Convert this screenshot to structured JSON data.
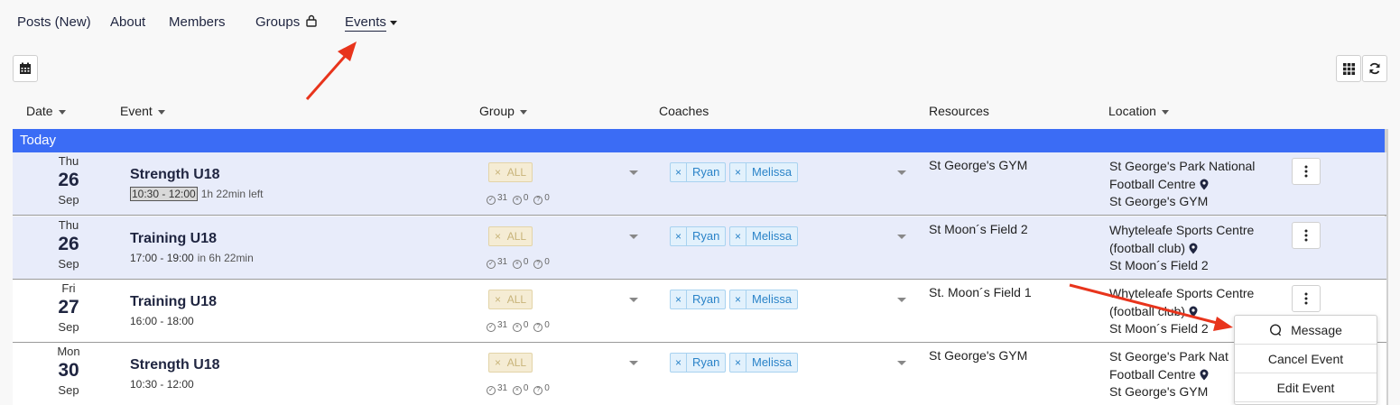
{
  "nav": {
    "items": [
      {
        "label": "Posts (New)"
      },
      {
        "label": "About"
      },
      {
        "label": "Members"
      },
      {
        "label": "Groups"
      },
      {
        "label": "Events"
      }
    ]
  },
  "table": {
    "columns": {
      "date": "Date",
      "event": "Event",
      "group": "Group",
      "coaches": "Coaches",
      "resources": "Resources",
      "location": "Location"
    },
    "section_label": "Today",
    "rows": [
      {
        "dow": "Thu",
        "day": "26",
        "month": "Sep",
        "title": "Strength U18",
        "time": "10:30 - 12:00",
        "remaining": "1h 22min left",
        "group_tag": "ALL",
        "group_remove": "×",
        "stats": {
          "yes": "31",
          "no": "0",
          "maybe": "0"
        },
        "coaches": [
          {
            "remove": "×",
            "name": "Ryan"
          },
          {
            "remove": "×",
            "name": "Melissa"
          }
        ],
        "resource": "St George's GYM",
        "location": [
          "St George's Park National",
          "Football Centre",
          "St George's GYM"
        ]
      },
      {
        "dow": "Thu",
        "day": "26",
        "month": "Sep",
        "title": "Training U18",
        "time": "17:00 - 19:00",
        "remaining": "in 6h 22min",
        "group_tag": "ALL",
        "group_remove": "×",
        "stats": {
          "yes": "31",
          "no": "0",
          "maybe": "0"
        },
        "coaches": [
          {
            "remove": "×",
            "name": "Ryan"
          },
          {
            "remove": "×",
            "name": "Melissa"
          }
        ],
        "resource": "St Moon´s Field 2",
        "location": [
          "Whyteleafe Sports Centre",
          "(football club)",
          "St Moon´s Field 2"
        ]
      },
      {
        "dow": "Fri",
        "day": "27",
        "month": "Sep",
        "title": "Training U18",
        "time": "16:00 - 18:00",
        "remaining": "",
        "group_tag": "ALL",
        "group_remove": "×",
        "stats": {
          "yes": "31",
          "no": "0",
          "maybe": "0"
        },
        "coaches": [
          {
            "remove": "×",
            "name": "Ryan"
          },
          {
            "remove": "×",
            "name": "Melissa"
          }
        ],
        "resource": "St. Moon´s Field 1",
        "location": [
          "Whyteleafe Sports Centre",
          "(football club)",
          "St Moon´s Field 2"
        ]
      },
      {
        "dow": "Mon",
        "day": "30",
        "month": "Sep",
        "title": "Strength U18",
        "time": "10:30 - 12:00",
        "remaining": "",
        "group_tag": "ALL",
        "group_remove": "×",
        "stats": {
          "yes": "31",
          "no": "0",
          "maybe": "0"
        },
        "coaches": [
          {
            "remove": "×",
            "name": "Ryan"
          },
          {
            "remove": "×",
            "name": "Melissa"
          }
        ],
        "resource": "St George's GYM",
        "location": [
          "St George's Park Nat",
          "Football Centre",
          "St George's GYM"
        ]
      }
    ]
  },
  "context_menu": {
    "message": "Message",
    "cancel": "Cancel Event",
    "edit": "Edit Event"
  },
  "icons": {
    "calendar": "calendar-icon",
    "grid": "grid-view-icon",
    "refresh": "refresh-icon",
    "lock": "lock-icon",
    "pin": "map-pin-icon",
    "more": "more-vertical-icon",
    "message": "chat-bubble-icon"
  },
  "colors": {
    "today_bar": "#3b6cf5",
    "highlight_row": "#e8ecfa",
    "annotation_arrow": "#e8341c"
  }
}
